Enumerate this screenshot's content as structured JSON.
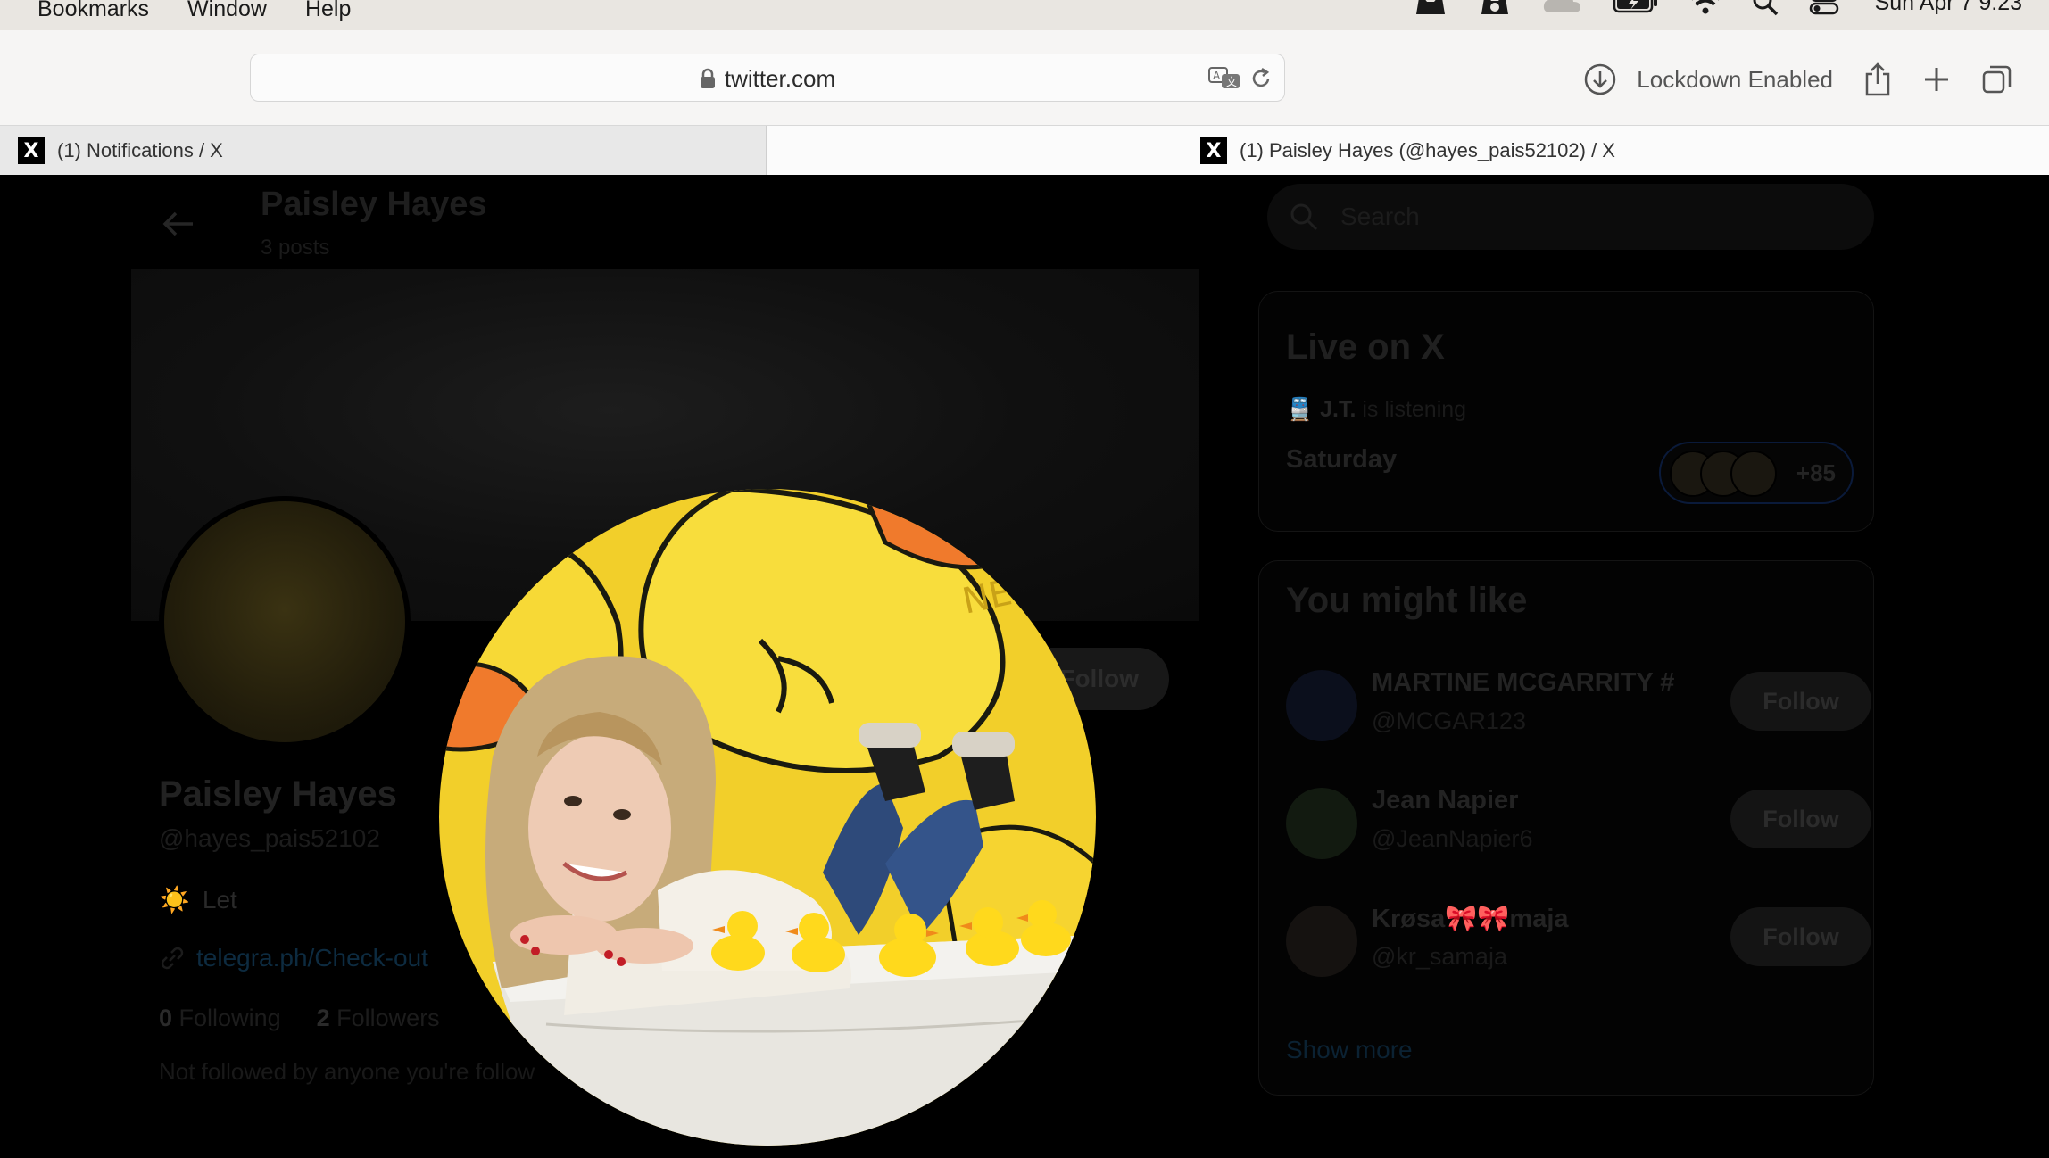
{
  "menubar": {
    "items": [
      "Bookmarks",
      "Window",
      "Help"
    ],
    "clock": "Sun Apr 7  9:23"
  },
  "toolbar": {
    "url": "twitter.com",
    "lockdown_label": "Lockdown Enabled"
  },
  "tabs": [
    {
      "title": "(1) Notifications / X",
      "favicon": "X"
    },
    {
      "title": "(1) Paisley Hayes (@hayes_pais52102) / X",
      "favicon": "X"
    }
  ],
  "profile_header": {
    "name": "Paisley Hayes",
    "posts": "3 posts"
  },
  "profile": {
    "name": "Paisley Hayes",
    "handle": "@hayes_pais52102",
    "bio_emoji": "☀️",
    "bio": "Let",
    "link": "telegra.ph/Check-out",
    "following_count": "0",
    "following_label": "Following",
    "followers_count": "2",
    "followers_label": "Followers",
    "not_followed": "Not followed by anyone you're follow",
    "follow_label": "Follow"
  },
  "sidebar": {
    "search_placeholder": "Search",
    "live": {
      "title": "Live on X",
      "listener_emoji": "🚆",
      "listener_name": "J.T.",
      "listener_text": "is listening",
      "day": "Saturday",
      "count": "+85"
    },
    "you_might_like": {
      "title": "You might like",
      "follow_label": "Follow",
      "items": [
        {
          "name": "MARTINE MCGARRITY #",
          "handle": "@MCGAR123"
        },
        {
          "name": "Jean Napier",
          "handle": "@JeanNapier6"
        },
        {
          "name": "Krøsa🎀🎀maja",
          "handle": "@kr_samaja"
        }
      ],
      "show_more": "Show more"
    }
  },
  "colors": {
    "menubar_bg": "#e9e6e1",
    "toolbar_bg": "#f6f5f4",
    "page_bg": "#000000",
    "duck_yellow": "#f2cf2a"
  }
}
